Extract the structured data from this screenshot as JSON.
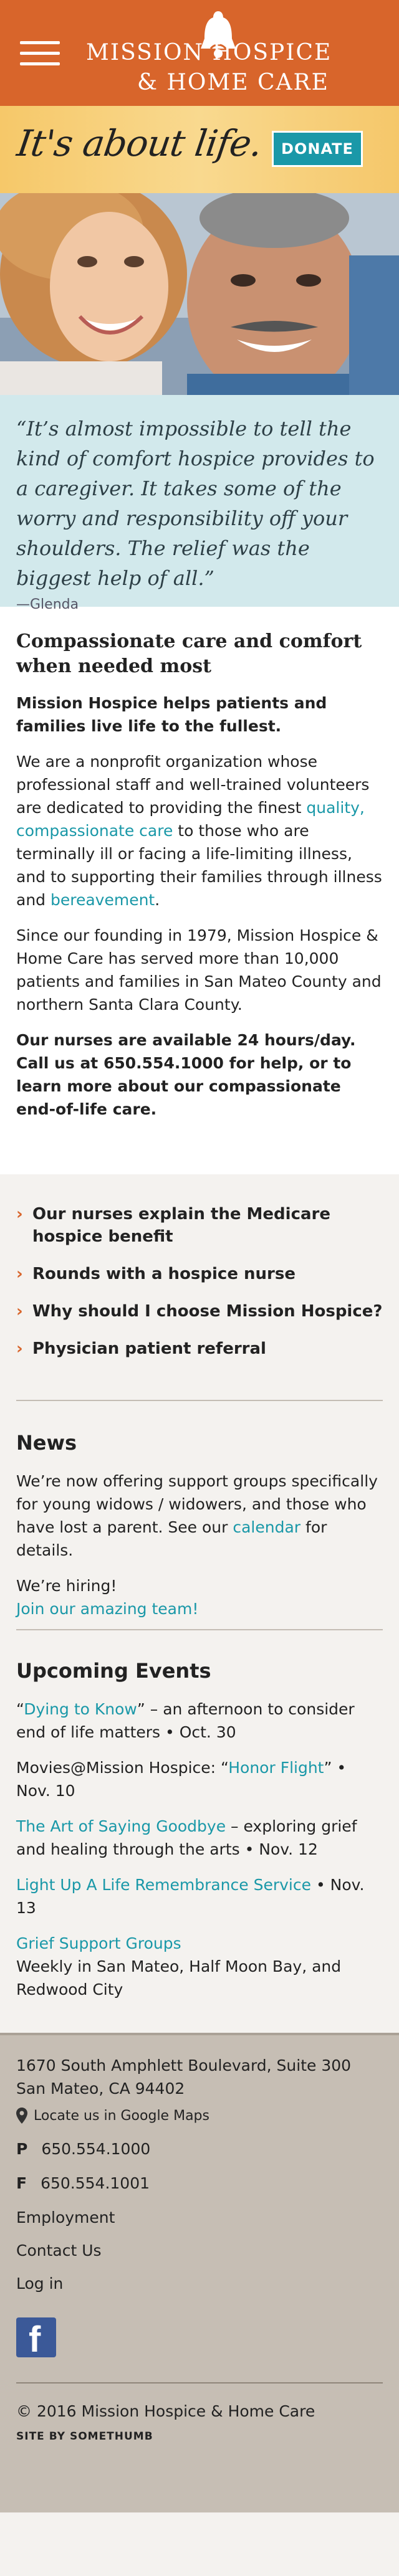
{
  "header": {
    "logo_line1": "MISSION  HOSPICE",
    "logo_line2": "& HOME CARE"
  },
  "tagline_bar": {
    "tagline": "It's about life.",
    "donate_label": "DONATE"
  },
  "quote": {
    "text": "“It’s almost impossible to tell the kind of comfort hospice provides to a caregiver. It takes some of the worry and responsibility off your shoulders. The relief was the biggest help of all.”",
    "author": "—Glenda"
  },
  "main": {
    "heading": "Compassionate care and comfort when needed most",
    "intro": "Mission Hospice helps patients and families live life to the fullest.",
    "p1_before": "We are a nonprofit organization whose professional staff and well-trained volunteers are dedicated to providing the finest ",
    "p1_link1": "quality, compassionate care",
    "p1_middle": " to those who are terminally ill or facing a life-limiting illness, and to supporting their families through illness and ",
    "p1_link2": "bereavement",
    "p1_end": ".",
    "p2": "Since our founding in 1979, Mission Hospice & Home Care has served more than 10,000 patients and families in San Mateo County and northern Santa Clara County.",
    "p3": "Our nurses are available 24 hours/day. Call us at 650.554.1000 for help, or to learn more about our compassionate end-of-life care."
  },
  "links": {
    "chevron": "›",
    "items": [
      "Our nurses explain the Medicare hospice benefit",
      "Rounds with a hospice nurse",
      "Why should I choose Mission Hospice?",
      "Physician patient referral"
    ]
  },
  "news": {
    "title": "News",
    "p1_before": "We’re now offering support groups specifically for young widows / widowers, and those who have lost a parent. See our ",
    "p1_link": "calendar",
    "p1_after": " for details.",
    "hiring": "We’re hiring!",
    "join_link": "Join our amazing team!"
  },
  "events": {
    "title": "Upcoming Events",
    "e1_open": "“",
    "e1_link": "Dying to Know",
    "e1_rest": "” – an afternoon to consider end of life matters • Oct. 30",
    "e2_before": "Movies@Mission Hospice: “",
    "e2_link": "Honor Flight",
    "e2_after": "” • Nov. 10",
    "e3_link": "The Art of Saying Goodbye",
    "e3_rest": " – exploring grief and healing through the arts • Nov. 12",
    "e4_link": "Light Up A Life Remembrance Service",
    "e4_rest": " • Nov. 13",
    "e5_link": "Grief Support Groups",
    "e5_rest": "Weekly in San Mateo, Half Moon Bay, and Redwood City"
  },
  "footer": {
    "address1": "1670 South Amphlett Boulevard, Suite 300",
    "address2": "San Mateo, CA 94402",
    "locate": "Locate us in Google Maps",
    "phone_label": "P",
    "phone": "650.554.1000",
    "fax_label": "F",
    "fax": "650.554.1001",
    "employment": "Employment",
    "contact": "Contact Us",
    "login": "Log in",
    "facebook_glyph": "f",
    "copyright": "© 2016 Mission Hospice & Home Care",
    "credit": "SITE BY SOMETHUMB"
  },
  "colors": {
    "brand_orange": "#d8652b",
    "teal": "#1a98a8",
    "quote_bg": "#d2e9ec",
    "footer_bg": "#c6beb4",
    "tagline_gold": "#f6c869"
  }
}
